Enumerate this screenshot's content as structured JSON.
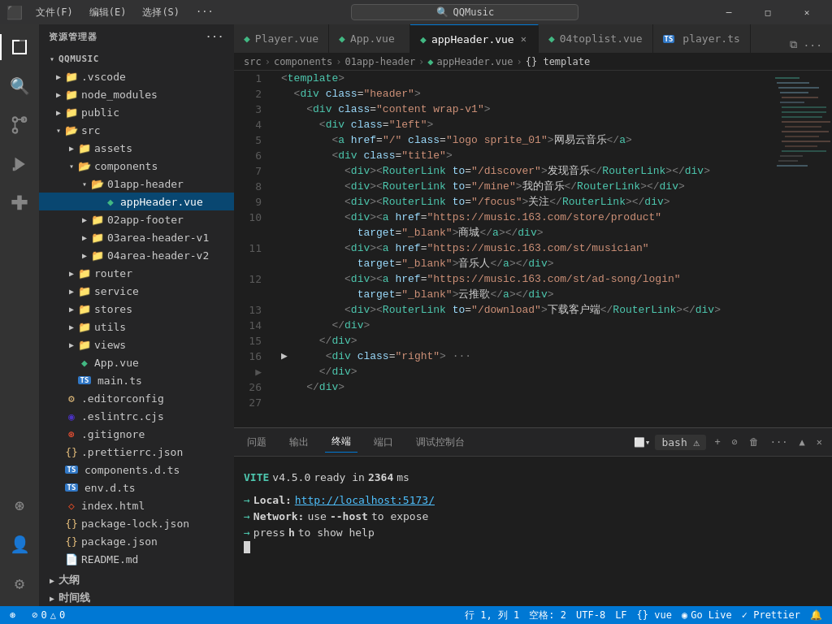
{
  "titlebar": {
    "menus": [
      "文件(F)",
      "编辑(E)",
      "选择(S)",
      "···"
    ],
    "search_placeholder": "QQMusic",
    "controls": [
      "⬜",
      "⬜",
      "⬜",
      "✕"
    ]
  },
  "activity_bar": {
    "icons": [
      {
        "name": "explorer-icon",
        "symbol": "⬜",
        "active": true
      },
      {
        "name": "search-icon",
        "symbol": "🔍",
        "active": false
      },
      {
        "name": "source-control-icon",
        "symbol": "⎇",
        "active": false
      },
      {
        "name": "run-icon",
        "symbol": "▶",
        "active": false
      },
      {
        "name": "extensions-icon",
        "symbol": "⊞",
        "active": false
      },
      {
        "name": "remote-icon",
        "symbol": "⊛",
        "active": false
      }
    ],
    "bottom_icons": [
      {
        "name": "account-icon",
        "symbol": "👤"
      },
      {
        "name": "settings-icon",
        "symbol": "⚙"
      }
    ]
  },
  "sidebar": {
    "title": "资源管理器",
    "root": "QQMUSIC",
    "tree": [
      {
        "id": "vscode",
        "label": ".vscode",
        "indent": 1,
        "type": "folder",
        "expanded": false
      },
      {
        "id": "node_modules",
        "label": "node_modules",
        "indent": 1,
        "type": "folder",
        "expanded": false
      },
      {
        "id": "public",
        "label": "public",
        "indent": 1,
        "type": "folder",
        "expanded": false
      },
      {
        "id": "src",
        "label": "src",
        "indent": 1,
        "type": "folder",
        "expanded": true
      },
      {
        "id": "assets",
        "label": "assets",
        "indent": 2,
        "type": "folder",
        "expanded": false
      },
      {
        "id": "components",
        "label": "components",
        "indent": 2,
        "type": "folder",
        "expanded": true
      },
      {
        "id": "01app-header",
        "label": "01app-header",
        "indent": 3,
        "type": "folder",
        "expanded": true
      },
      {
        "id": "appHeader.vue",
        "label": "appHeader.vue",
        "indent": 4,
        "type": "vue",
        "active": true
      },
      {
        "id": "02app-footer",
        "label": "02app-footer",
        "indent": 3,
        "type": "folder",
        "expanded": false
      },
      {
        "id": "03area-header-v1",
        "label": "03area-header-v1",
        "indent": 3,
        "type": "folder",
        "expanded": false
      },
      {
        "id": "04area-header-v2",
        "label": "04area-header-v2",
        "indent": 3,
        "type": "folder",
        "expanded": false
      },
      {
        "id": "router",
        "label": "router",
        "indent": 2,
        "type": "folder",
        "expanded": false
      },
      {
        "id": "service",
        "label": "service",
        "indent": 2,
        "type": "folder",
        "expanded": false
      },
      {
        "id": "stores",
        "label": "stores",
        "indent": 2,
        "type": "folder",
        "expanded": false
      },
      {
        "id": "utils",
        "label": "utils",
        "indent": 2,
        "type": "folder",
        "expanded": false
      },
      {
        "id": "views",
        "label": "views",
        "indent": 2,
        "type": "folder",
        "expanded": false
      },
      {
        "id": "App.vue",
        "label": "App.vue",
        "indent": 2,
        "type": "vue"
      },
      {
        "id": "main.ts",
        "label": "main.ts",
        "indent": 2,
        "type": "ts"
      },
      {
        "id": ".editorconfig",
        "label": ".editorconfig",
        "indent": 1,
        "type": "config"
      },
      {
        "id": ".eslintrc.cjs",
        "label": ".eslintrc.cjs",
        "indent": 1,
        "type": "eslint"
      },
      {
        "id": ".gitignore",
        "label": ".gitignore",
        "indent": 1,
        "type": "git"
      },
      {
        "id": ".prettierrc.json",
        "label": ".prettierrc.json",
        "indent": 1,
        "type": "json"
      },
      {
        "id": "components.d.ts",
        "label": "components.d.ts",
        "indent": 1,
        "type": "ts"
      },
      {
        "id": "env.d.ts",
        "label": "env.d.ts",
        "indent": 1,
        "type": "ts"
      },
      {
        "id": "index.html",
        "label": "index.html",
        "indent": 1,
        "type": "html"
      },
      {
        "id": "package-lock.json",
        "label": "package-lock.json",
        "indent": 1,
        "type": "json"
      },
      {
        "id": "package.json",
        "label": "package.json",
        "indent": 1,
        "type": "json"
      },
      {
        "id": "README.md",
        "label": "README.md",
        "indent": 1,
        "type": "md"
      },
      {
        "id": "大纲",
        "label": "大纲",
        "indent": 0,
        "type": "section"
      },
      {
        "id": "时间线",
        "label": "时间线",
        "indent": 0,
        "type": "section"
      }
    ]
  },
  "tabs": [
    {
      "label": "Player.vue",
      "type": "vue",
      "active": false
    },
    {
      "label": "App.vue",
      "type": "vue",
      "active": false
    },
    {
      "label": "appHeader.vue",
      "type": "vue",
      "active": true
    },
    {
      "label": "04toplist.vue",
      "type": "vue",
      "active": false
    },
    {
      "label": "player.ts",
      "type": "ts",
      "active": false
    }
  ],
  "breadcrumb": [
    "src",
    "components",
    "01app-header",
    "appHeader.vue",
    "{} template"
  ],
  "code_lines": [
    {
      "num": 1,
      "content": "<template>",
      "tokens": [
        {
          "t": "punct",
          "v": "<"
        },
        {
          "t": "tag",
          "v": "template"
        },
        {
          "t": "punct",
          "v": ">"
        }
      ]
    },
    {
      "num": 2,
      "content": "  <div class=\"header\">",
      "tokens": [
        {
          "t": "punct",
          "v": "  <"
        },
        {
          "t": "tag",
          "v": "div"
        },
        {
          "t": "attr-name",
          "v": " class"
        },
        {
          "t": "equals",
          "v": "="
        },
        {
          "t": "attr-value",
          "v": "\"header\""
        },
        {
          "t": "punct",
          "v": ">"
        }
      ]
    },
    {
      "num": 3,
      "content": "    <div class=\"content wrap-v1\">",
      "tokens": [
        {
          "t": "punct",
          "v": "    <"
        },
        {
          "t": "tag",
          "v": "div"
        },
        {
          "t": "attr-name",
          "v": " class"
        },
        {
          "t": "equals",
          "v": "="
        },
        {
          "t": "attr-value",
          "v": "\"content wrap-v1\""
        },
        {
          "t": "punct",
          "v": ">"
        }
      ]
    },
    {
      "num": 4,
      "content": "      <div class=\"left\">",
      "tokens": [
        {
          "t": "punct",
          "v": "      <"
        },
        {
          "t": "tag",
          "v": "div"
        },
        {
          "t": "attr-name",
          "v": " class"
        },
        {
          "t": "equals",
          "v": "="
        },
        {
          "t": "attr-value",
          "v": "\"left\""
        },
        {
          "t": "punct",
          "v": ">"
        }
      ]
    },
    {
      "num": 5,
      "content": "        <a href=\"/\" class=\"logo sprite_01\">网易云音乐</a>",
      "raw": true
    },
    {
      "num": 6,
      "content": "        <div class=\"title\">",
      "tokens": [
        {
          "t": "punct",
          "v": "        <"
        },
        {
          "t": "tag",
          "v": "div"
        },
        {
          "t": "attr-name",
          "v": " class"
        },
        {
          "t": "equals",
          "v": "="
        },
        {
          "t": "attr-value",
          "v": "\"title\""
        },
        {
          "t": "punct",
          "v": ">"
        }
      ]
    },
    {
      "num": 7,
      "content": "          <div><RouterLink to=\"/discover\">发现音乐</RouterLink></div>",
      "raw": true
    },
    {
      "num": 8,
      "content": "          <div><RouterLink to=\"/mine\">我的音乐</RouterLink></div>",
      "raw": true
    },
    {
      "num": 9,
      "content": "          <div><RouterLink to=\"/focus\">关注</RouterLink></div>",
      "raw": true
    },
    {
      "num": 10,
      "content": "          <div><a href=\"https://music.163.com/store/product\"",
      "raw": true
    },
    {
      "num": 10,
      "content": "            target=\"_blank\">商城</a></div>",
      "raw": true,
      "indent_only": true
    },
    {
      "num": 11,
      "content": "          <div><a href=\"https://music.163.com/st/musician\"",
      "raw": true
    },
    {
      "num": 11,
      "content": "            target=\"_blank\">音乐人</a></div>",
      "raw": true,
      "indent_only": true
    },
    {
      "num": 12,
      "content": "          <div><a href=\"https://music.163.com/st/ad-song/login\"",
      "raw": true
    },
    {
      "num": 12,
      "content": "            target=\"_blank\">云推歌</a></div>",
      "raw": true,
      "indent_only": true
    },
    {
      "num": 13,
      "content": "          <div><RouterLink to=\"/download\">下载客户端</RouterLink></div>",
      "raw": true
    },
    {
      "num": 14,
      "content": "        </div>",
      "raw": true
    },
    {
      "num": 15,
      "content": "      </div>",
      "raw": true
    },
    {
      "num": 16,
      "content": "      <div class=\"right\">····",
      "raw": true
    },
    {
      "num": 26,
      "content": "      </div>",
      "raw": true
    },
    {
      "num": 27,
      "content": "    </div>",
      "raw": true
    }
  ],
  "terminal": {
    "tabs": [
      "问题",
      "输出",
      "终端",
      "端口",
      "调试控制台"
    ],
    "active_tab": "终端",
    "shell": "bash",
    "lines": [
      {
        "type": "blank"
      },
      {
        "type": "vite",
        "text": "VITE v4.5.0  ready in 2364 ms"
      },
      {
        "type": "blank"
      },
      {
        "type": "arrow",
        "label": "Local:",
        "value": "http://localhost:5173/"
      },
      {
        "type": "arrow_plain",
        "label": "Network:",
        "value": "use --host to expose"
      },
      {
        "type": "arrow_plain",
        "label": "press",
        "value": "h to show help"
      },
      {
        "type": "cursor"
      }
    ]
  },
  "statusbar": {
    "left": [
      {
        "icon": "⊛",
        "label": "0 △ 0"
      },
      {
        "label": "行 1, 列 1"
      },
      {
        "label": "空格: 2"
      },
      {
        "label": "UTF-8"
      },
      {
        "label": "LF"
      },
      {
        "label": "{} vue"
      }
    ],
    "right": [
      {
        "label": "◉ Go Live"
      },
      {
        "label": "✓ Prettier"
      },
      {
        "label": "🔔"
      }
    ]
  }
}
